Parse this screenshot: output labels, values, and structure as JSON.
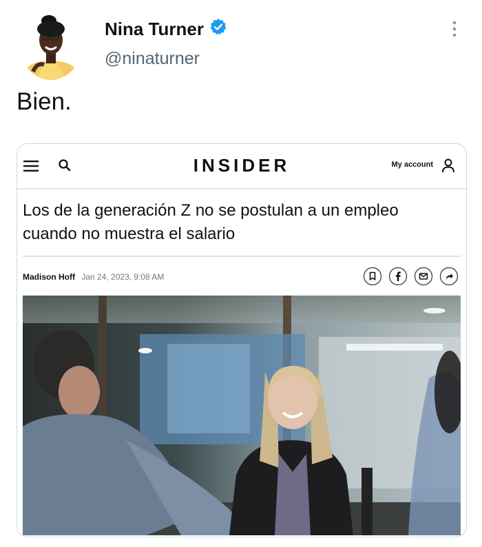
{
  "tweet": {
    "display_name": "Nina Turner",
    "handle": "@ninaturner",
    "text": "Bien.",
    "verified_icon": "verified-badge-icon",
    "more_icon": "more-options-icon"
  },
  "card": {
    "nav": {
      "logo": "INSIDER",
      "account_label": "My account",
      "menu_icon": "hamburger-menu-icon",
      "search_icon": "search-icon",
      "user_icon": "user-icon"
    },
    "headline": "Los de la generación Z no se postulan a un empleo cuando no muestra el salario",
    "byline": {
      "author": "Madison Hoff",
      "date": "Jan 24, 2023, 9:08 AM"
    },
    "share_icons": [
      "bookmark-icon",
      "facebook-icon",
      "email-icon",
      "share-icon"
    ]
  },
  "colors": {
    "verified": "#1d9bf0",
    "secondary_text": "#536471",
    "card_border": "#cfd9de"
  }
}
